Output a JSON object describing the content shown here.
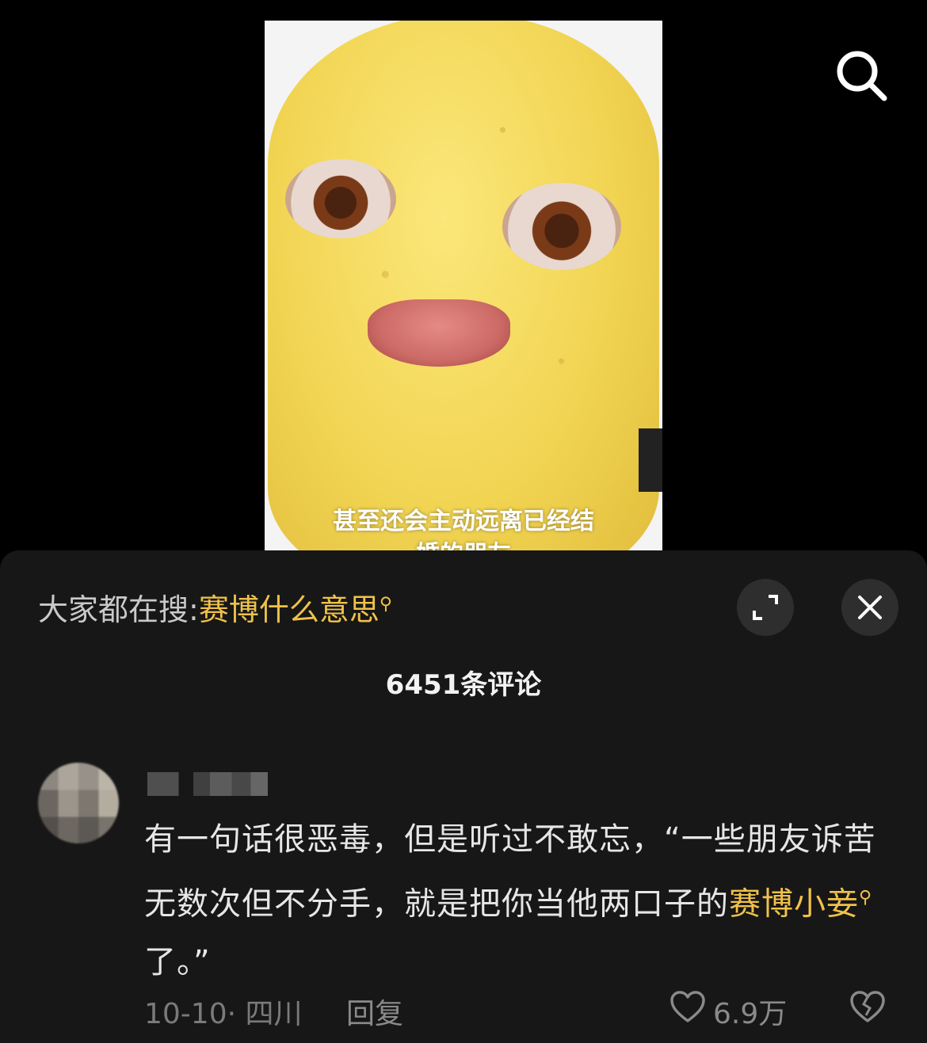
{
  "video": {
    "subtitle_line1": "甚至还会主动远离已经结",
    "subtitle_line2": "婚的朋友"
  },
  "top_bar": {
    "search_icon": "search-icon"
  },
  "panel": {
    "hot_search_prefix": "大家都在搜:",
    "hot_search_keyword": "赛博什么意思",
    "expand_icon": "expand-icon",
    "close_icon": "close-icon",
    "comment_count": "6451条评论"
  },
  "comment": {
    "text_part1": "有一句话很恶毒，但是听过不敢忘，“一些朋友诉苦无数次但不分手，就是把你当他两口子的",
    "keyword": "赛博小妾",
    "text_part2": "了。”",
    "date": "10-10",
    "location": "四川",
    "date_location": "10-10· 四川",
    "reply_label": "回复",
    "like_count": "6.9万",
    "like_icon": "heart-icon",
    "dislike_icon": "broken-heart-icon"
  },
  "colors": {
    "accent": "#f0c24a",
    "panel_bg": "#171717"
  }
}
